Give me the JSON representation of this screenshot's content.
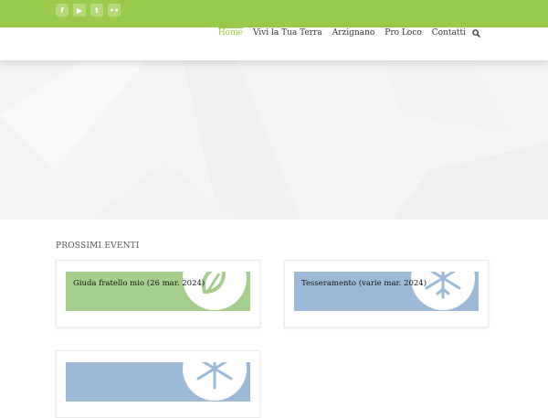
{
  "colors": {
    "accent_green": "#9bcb4b",
    "card_green": "#a6ce8e",
    "card_blue": "#9cbad8"
  },
  "social_icons": [
    {
      "name": "facebook-icon",
      "glyph": "f"
    },
    {
      "name": "youtube-icon",
      "glyph": "▶"
    },
    {
      "name": "twitter-icon",
      "glyph": "t"
    },
    {
      "name": "flickr-icon",
      "glyph": "••"
    }
  ],
  "nav": {
    "items": [
      "Home",
      "Vivi la Tua Terra",
      "Arzignano",
      "Pro Loco",
      "Contatti"
    ],
    "active_index": 0
  },
  "events": {
    "section_title": "PROSSIMI EVENTI",
    "cards": [
      {
        "label": "Giuda fratello mio (26 mar. 2024)",
        "color": "#a6ce8e",
        "icon": "leaf-icon"
      },
      {
        "label": "Tesseramento (varie mar. 2024)",
        "color": "#9cbad8",
        "icon": "snowflake-icon"
      },
      {
        "label": "",
        "color": "#9cbad8",
        "icon": "snowflake-icon"
      }
    ]
  }
}
